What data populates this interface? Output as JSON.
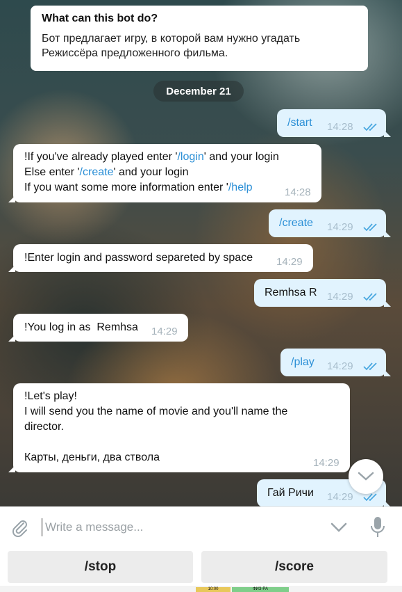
{
  "bot_info": {
    "title": "What can this bot do?",
    "text_line1": "Бот предлагает игру, в которой вам нужно угадать",
    "text_line2": "Режиссёра предложенного фильма."
  },
  "date_label": "December 21",
  "messages": [
    {
      "dir": "out",
      "text": "/start",
      "time": "14:28"
    },
    {
      "dir": "in",
      "line1_a": "!If you've already played enter '",
      "line1_cmd": "/login",
      "line1_b": "' and your login",
      "line2_a": "Else enter '",
      "line2_cmd": "/create",
      "line2_b": "' and your login",
      "line3_a": "If you want some more information enter '",
      "line3_cmd": "/help",
      "time": "14:28"
    },
    {
      "dir": "out",
      "text": "/create",
      "time": "14:29"
    },
    {
      "dir": "in",
      "text": "!Enter login and password separeted by space",
      "time": "14:29"
    },
    {
      "dir": "out",
      "text": "Remhsa R",
      "time": "14:29"
    },
    {
      "dir": "in",
      "text": "!You log in as  Remhsa",
      "time": "14:29"
    },
    {
      "dir": "out",
      "text": "/play",
      "time": "14:29"
    },
    {
      "dir": "in",
      "line1": "!Let's play!",
      "line2": "I will send you the name of movie and you'll name the",
      "line3": "director.",
      "line4": "Карты, деньги, два ствола",
      "time": "14:29"
    },
    {
      "dir": "out",
      "text": "Гай Ричи",
      "time": "14:29"
    }
  ],
  "composer": {
    "placeholder": "Write a message..."
  },
  "keyboard": {
    "buttons": [
      "/stop",
      "/score"
    ]
  },
  "bottom_strip": {
    "left": "10:00",
    "right": "ФИЗ-РА"
  },
  "icons": {
    "attach": "paperclip-icon",
    "mic": "microphone-icon",
    "toggle": "chevron-down-icon",
    "read": "double-check-icon"
  },
  "colors": {
    "accent": "#2b8fd6",
    "outgoing_bubble": "#e1f3fe",
    "check": "#4aa8e0"
  }
}
